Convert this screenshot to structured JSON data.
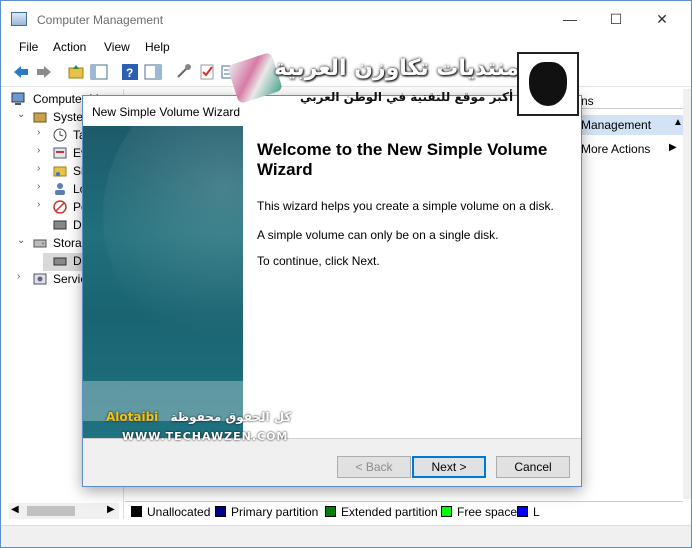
{
  "window": {
    "title": "Computer Management"
  },
  "menu": [
    "File",
    "Action",
    "View",
    "Help"
  ],
  "tree": [
    {
      "label": "Computer M",
      "level": 0,
      "arrow": ""
    },
    {
      "label": "Systen",
      "level": 1,
      "arrow": "⌄"
    },
    {
      "label": "Ta",
      "level": 2,
      "arrow": "›"
    },
    {
      "label": "Ev",
      "level": 2,
      "arrow": "›"
    },
    {
      "label": "Sh",
      "level": 2,
      "arrow": "›"
    },
    {
      "label": "Lo",
      "level": 2,
      "arrow": "›"
    },
    {
      "label": "Pe",
      "level": 2,
      "arrow": "›"
    },
    {
      "label": "De",
      "level": 2,
      "arrow": ""
    },
    {
      "label": "Storag",
      "level": 1,
      "arrow": "⌄"
    },
    {
      "label": "Di",
      "level": 2,
      "arrow": ""
    },
    {
      "label": "Servic",
      "level": 1,
      "arrow": "›"
    }
  ],
  "actions": {
    "header": "ns",
    "selected": "Management",
    "more": "More Actions"
  },
  "legend": [
    {
      "label": "Unallocated",
      "color": "#000000"
    },
    {
      "label": "Primary partition",
      "color": "#00008b"
    },
    {
      "label": "Extended partition",
      "color": "#008000"
    },
    {
      "label": "Free space",
      "color": "#00ff00"
    },
    {
      "label": "L",
      "color": "#0000ff"
    }
  ],
  "dialog": {
    "title": "New Simple Volume Wizard",
    "heading": "Welcome to the New Simple Volume Wizard",
    "p1": "This wizard helps you create a simple volume on a disk.",
    "p2": "A simple volume can only be on a single disk.",
    "p3": "To continue, click Next.",
    "back": "< Back",
    "next": "Next >",
    "cancel": "Cancel"
  },
  "watermark": {
    "arabic_title": "منتديات تكاوزن العربية",
    "arabic_sub": "أكبر موقع للتقنية في الوطن العربي",
    "credit": "كل الحقوق محفوظة",
    "author": "Alotaibi",
    "site": "WWW.TECHAWZEN.COM"
  }
}
